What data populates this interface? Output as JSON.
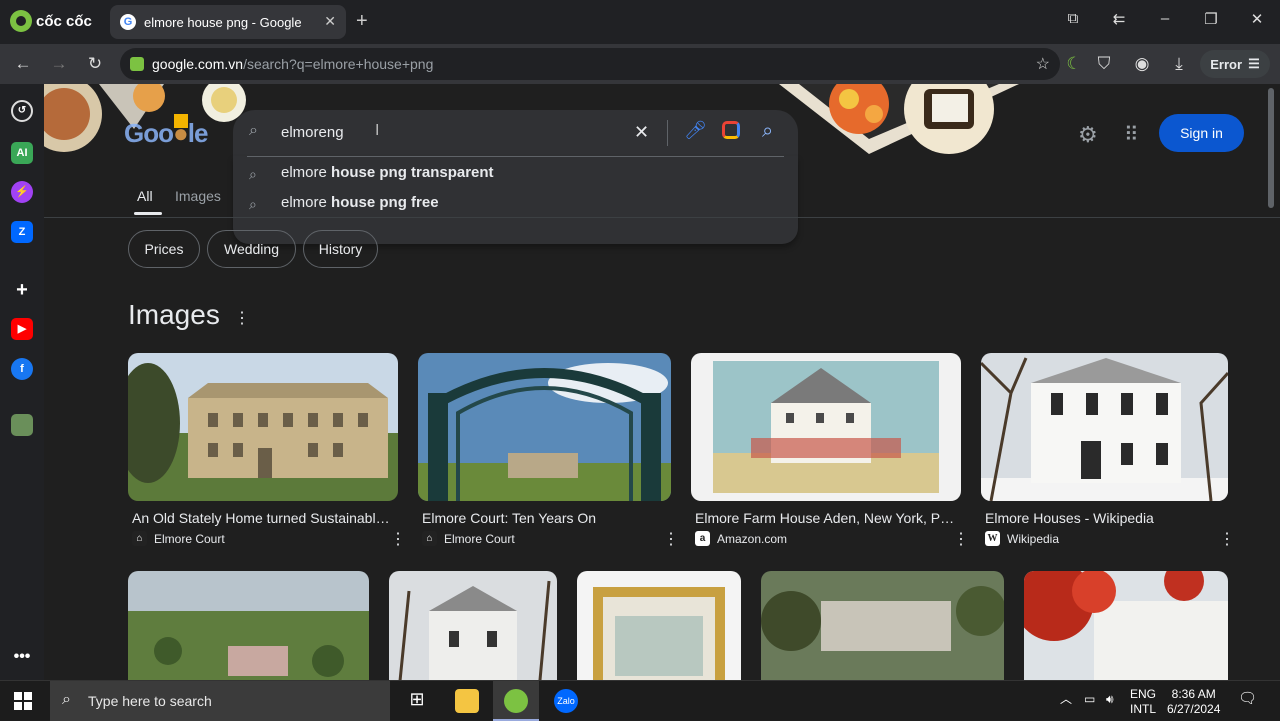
{
  "browser": {
    "brand": "cốc cốc",
    "tab_title": "elmore house png - Google",
    "url_host": "google.com.vn",
    "url_path": "/search?q=elmore+house+png",
    "error_label": "Error"
  },
  "search": {
    "query": "elmoreng",
    "suggestions": [
      {
        "prefix": "elmore ",
        "bold": "house png transparent"
      },
      {
        "prefix": "elmore ",
        "bold": "house png free"
      }
    ]
  },
  "tabs": {
    "all": "All",
    "images": "Images"
  },
  "chips": [
    "Prices",
    "Wedding",
    "History"
  ],
  "header": {
    "sign_in": "Sign in"
  },
  "images_section": {
    "title": "Images",
    "cards": [
      {
        "title": "An Old Stately Home turned Sustainabl…",
        "source": "Elmore Court",
        "favicon": "house-favicon"
      },
      {
        "title": "Elmore Court: Ten Years On",
        "source": "Elmore Court",
        "favicon": "house-favicon"
      },
      {
        "title": "Elmore Farm House Aden, New York, P…",
        "source": "Amazon.com",
        "favicon": "amazon-favicon"
      },
      {
        "title": "Elmore Houses - Wikipedia",
        "source": "Wikipedia",
        "favicon": "wikipedia-favicon"
      }
    ]
  },
  "taskbar": {
    "search_placeholder": "Type here to search",
    "lang_top": "ENG",
    "lang_bottom": "INTL",
    "time": "8:36 AM",
    "date": "6/27/2024"
  },
  "colors": {
    "accent_blue": "#0b57d0",
    "coccoc_green": "#7cc242",
    "link_blue": "#8ab4f8"
  }
}
